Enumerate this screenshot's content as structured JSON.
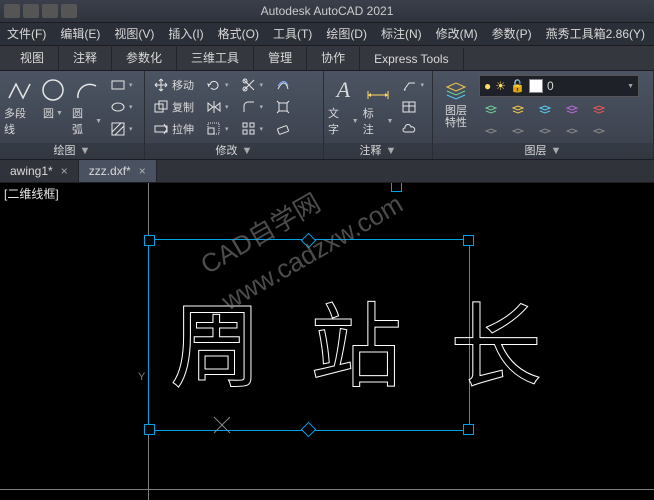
{
  "title": "Autodesk AutoCAD 2021",
  "menus": [
    "文件(F)",
    "编辑(E)",
    "视图(V)",
    "插入(I)",
    "格式(O)",
    "工具(T)",
    "绘图(D)",
    "标注(N)",
    "修改(M)",
    "参数(P)",
    "燕秀工具箱2.86(Y)"
  ],
  "ribbon_tabs": [
    "视图",
    "注释",
    "参数化",
    "三维工具",
    "管理",
    "协作",
    "Express Tools"
  ],
  "draw_panel": {
    "title": "绘图",
    "polyline": "多段线",
    "circle": "圆",
    "arc": "圆弧"
  },
  "modify_panel": {
    "title": "修改",
    "move": "移动",
    "copy": "复制",
    "stretch": "拉伸"
  },
  "annot_panel": {
    "title": "注释",
    "text": "文字",
    "dim": "标注"
  },
  "layer_panel": {
    "title": "图层",
    "props": "图层\n特性",
    "value": "0"
  },
  "doc_tabs": [
    {
      "name": "awing1*"
    },
    {
      "name": "zzz.dxf*"
    }
  ],
  "viewport_style": "[二维线框]",
  "canvas_text": "周站长",
  "watermark": {
    "line1": "CAD自学网",
    "line2": "www.cadzxw.com"
  }
}
